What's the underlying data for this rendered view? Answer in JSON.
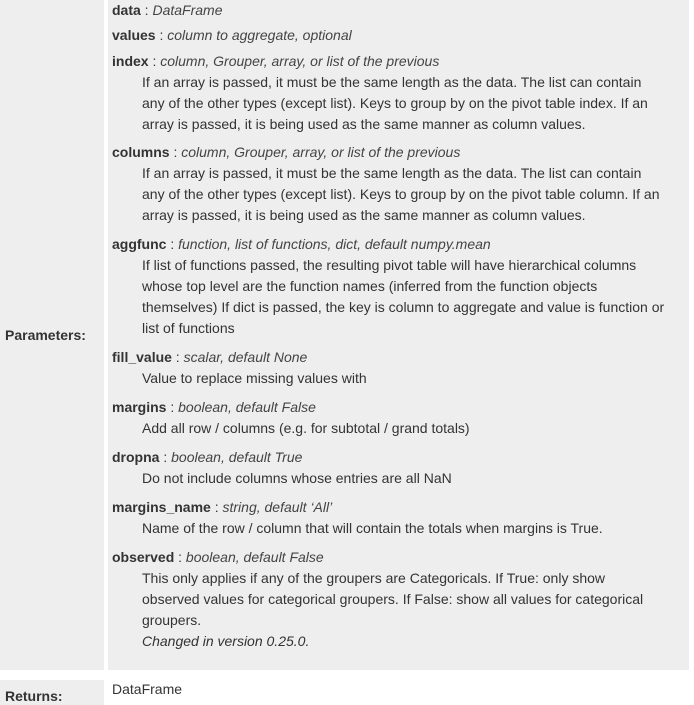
{
  "parameters_label": "Parameters:",
  "returns_label": "Returns:",
  "returns_value": "DataFrame",
  "params": [
    {
      "name": "data",
      "type": "DataFrame",
      "desc": [],
      "note": ""
    },
    {
      "name": "values",
      "type": "column to aggregate, optional",
      "desc": [],
      "note": ""
    },
    {
      "name": "index",
      "type": "column, Grouper, array, or list of the previous",
      "desc": [
        "If an array is passed, it must be the same length as the data. The list can contain",
        "any of the other types (except list). Keys to group by on the pivot table index. If an",
        "array is passed, it is being used as the same manner as column values."
      ],
      "note": ""
    },
    {
      "name": "columns",
      "type": "column, Grouper, array, or list of the previous",
      "desc": [
        "If an array is passed, it must be the same length as the data. The list can contain",
        "any of the other types (except list). Keys to group by on the pivot table column. If an",
        "array is passed, it is being used as the same manner as column values."
      ],
      "note": ""
    },
    {
      "name": "aggfunc",
      "type": "function, list of functions, dict, default numpy.mean",
      "desc": [
        "If list of functions passed, the resulting pivot table will have hierarchical columns",
        "whose top level are the function names (inferred from the function objects",
        "themselves) If dict is passed, the key is column to aggregate and value is function or",
        "list of functions"
      ],
      "note": ""
    },
    {
      "name": "fill_value",
      "type": "scalar, default None",
      "desc": [
        "Value to replace missing values with"
      ],
      "note": ""
    },
    {
      "name": "margins",
      "type": "boolean, default False",
      "desc": [
        "Add all row / columns (e.g. for subtotal / grand totals)"
      ],
      "note": ""
    },
    {
      "name": "dropna",
      "type": "boolean, default True",
      "desc": [
        "Do not include columns whose entries are all NaN"
      ],
      "note": ""
    },
    {
      "name": "margins_name",
      "type": "string, default ‘All’",
      "desc": [
        "Name of the row / column that will contain the totals when margins is True."
      ],
      "note": ""
    },
    {
      "name": "observed",
      "type": "boolean, default False",
      "desc": [
        "This only applies if any of the groupers are Categoricals. If True: only show",
        "observed values for categorical groupers. If False: show all values for categorical",
        "groupers."
      ],
      "note": "Changed in version 0.25.0."
    }
  ]
}
